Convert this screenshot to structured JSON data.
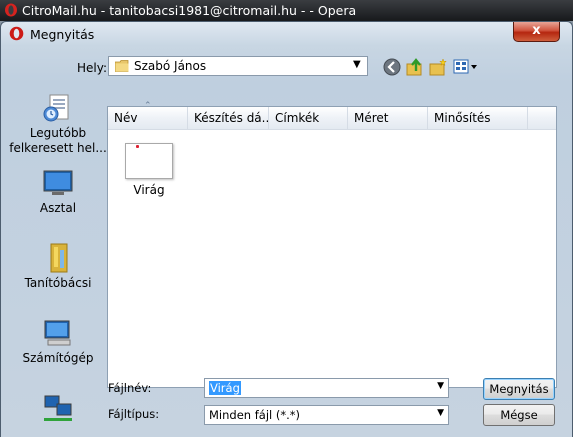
{
  "window": {
    "title": "CitroMail.hu - tanitobacsi1981@citromail.hu - - Opera"
  },
  "dialog": {
    "title": "Megnyitás",
    "close_label": "x"
  },
  "location": {
    "label": "Hely:",
    "value": "Szabó János"
  },
  "toolbar": {
    "icons": [
      "back-icon",
      "up-folder-icon",
      "new-folder-icon",
      "view-menu-icon"
    ]
  },
  "places": [
    {
      "label": "Legutóbb felkeresett hel...",
      "icon": "recent-places-icon"
    },
    {
      "label": "Asztal",
      "icon": "desktop-icon"
    },
    {
      "label": "Tanítóbácsi",
      "icon": "user-folder-icon"
    },
    {
      "label": "Számítógép",
      "icon": "computer-icon"
    },
    {
      "label": "",
      "icon": "network-icon"
    }
  ],
  "file_list": {
    "columns": [
      "Név",
      "Készítés dá...",
      "Címkék",
      "Méret",
      "Minősítés"
    ],
    "sorted_column": "Név",
    "items": [
      {
        "name": "Virág"
      }
    ]
  },
  "filename": {
    "label": "Fájlnév:",
    "value": "Virág"
  },
  "filetype": {
    "label": "Fájltípus:",
    "value": "Minden fájl (*.*)"
  },
  "buttons": {
    "open": "Megnyitás",
    "cancel": "Mégse"
  },
  "colors": {
    "selection": "#3399ff",
    "close_button": "#c8402a"
  }
}
